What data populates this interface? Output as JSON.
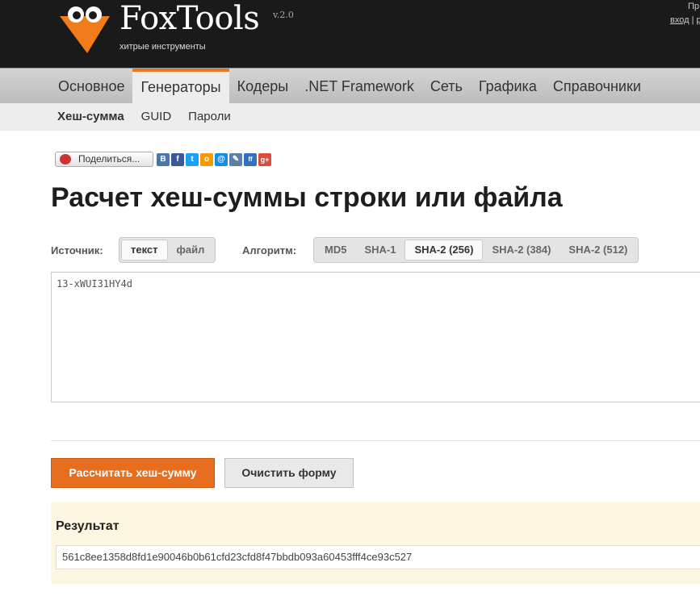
{
  "header": {
    "brand": "FoxTools",
    "version": "v.2.0",
    "tagline": "хитрые инструменты",
    "top_right_1": "Пр",
    "login": "вход",
    "sep": "|",
    "partial_link": "р"
  },
  "main_nav": [
    "Основное",
    "Генераторы",
    "Кодеры",
    ".NET Framework",
    "Сеть",
    "Графика",
    "Справочники"
  ],
  "sub_nav": [
    "Хеш-сумма",
    "GUID",
    "Пароли"
  ],
  "share": {
    "label": "Поделиться...",
    "icons": [
      {
        "name": "vk-icon",
        "glyph": "В",
        "color": "#4a76a8"
      },
      {
        "name": "facebook-icon",
        "glyph": "f",
        "color": "#3b5998"
      },
      {
        "name": "twitter-icon",
        "glyph": "t",
        "color": "#1da1f2"
      },
      {
        "name": "odnoklassniki-icon",
        "glyph": "о",
        "color": "#f59a00"
      },
      {
        "name": "mail-icon",
        "glyph": "@",
        "color": "#168de2"
      },
      {
        "name": "livejournal-icon",
        "glyph": "✎",
        "color": "#5b7fa6"
      },
      {
        "name": "friendfeed-icon",
        "glyph": "ff",
        "color": "#2f72c4"
      },
      {
        "name": "google-plus-icon",
        "glyph": "g+",
        "color": "#dd4b39"
      }
    ]
  },
  "title": "Расчет хеш-суммы строки или файла",
  "source": {
    "label": "Источник:",
    "options": [
      "текст",
      "файл"
    ],
    "selected": "текст"
  },
  "algorithm": {
    "label": "Алгоритм:",
    "options": [
      "MD5",
      "SHA-1",
      "SHA-2 (256)",
      "SHA-2 (384)",
      "SHA-2 (512)"
    ],
    "selected": "SHA-2 (256)"
  },
  "input_text": "13-xWUI31HY4d",
  "buttons": {
    "calculate": "Рассчитать хеш-сумму",
    "clear": "Очистить форму"
  },
  "result": {
    "title": "Результат",
    "value": "561c8ee1358d8fd1e90046b0b61cfd23cfd8f47bbdb093a60453fff4ce93c527"
  },
  "colors": {
    "accent": "#e66e1e",
    "header_bg": "#1a1a1a",
    "result_bg": "#fdf6e0"
  }
}
